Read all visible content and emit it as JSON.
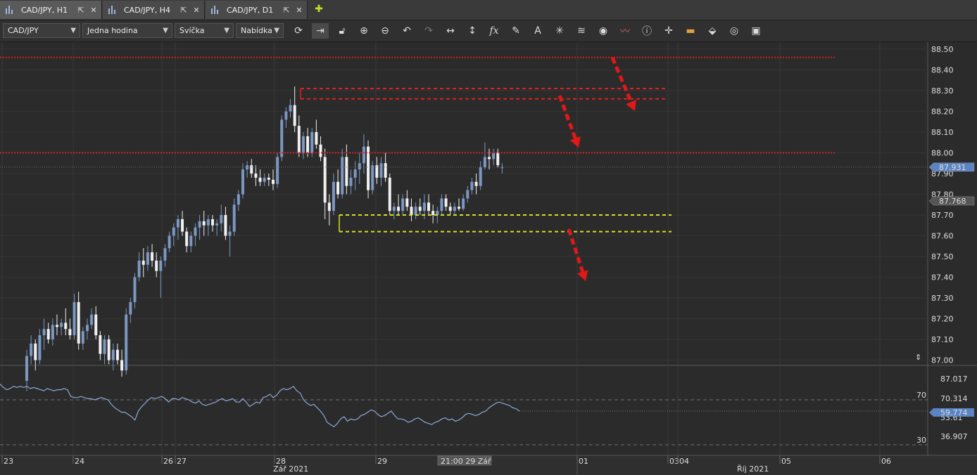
{
  "tabs": [
    {
      "label": "CAD/JPY, H1",
      "active": true
    },
    {
      "label": "CAD/JPY, H4",
      "active": false
    },
    {
      "label": "CAD/JPY, D1",
      "active": false
    }
  ],
  "toolbar": {
    "symbol": "CAD/JPY",
    "timeframe": "Jedna hodina",
    "chart_type": "Svíčka",
    "menu": "Nabídka"
  },
  "chart_data": [
    {
      "type": "candlestick",
      "title": "CAD/JPY, H1",
      "ylim": [
        87.0,
        88.55
      ],
      "y_ticks": [
        "88.50",
        "88.40",
        "88.30",
        "88.20",
        "88.10",
        "88.00",
        "87.90",
        "87.80",
        "87.70",
        "87.60",
        "87.50",
        "87.40",
        "87.30",
        "87.20",
        "87.10",
        "87.00"
      ],
      "x_ticks": [
        "23",
        "24",
        "26",
        "27",
        "28",
        "29",
        "01",
        "03",
        "04",
        "05",
        "06"
      ],
      "x_group_labels": [
        "Zář 2021",
        "Říj 2021"
      ],
      "crosshair_time_label": "21:00 29 Zář",
      "price_labels": [
        {
          "value": "87.931",
          "color": "#5b84c4"
        },
        {
          "value": "87.768",
          "color": "#555555"
        }
      ],
      "bull_color": "#7b97c2",
      "bear_color": "#f0f0f0",
      "candles": [
        {
          "o": 86.9,
          "h": 87.05,
          "l": 86.85,
          "c": 87.02
        },
        {
          "o": 87.02,
          "h": 87.12,
          "l": 86.98,
          "c": 87.08
        },
        {
          "o": 87.08,
          "h": 87.1,
          "l": 86.95,
          "c": 87.0
        },
        {
          "o": 87.0,
          "h": 87.15,
          "l": 86.98,
          "c": 87.12
        },
        {
          "o": 87.12,
          "h": 87.2,
          "l": 87.05,
          "c": 87.15
        },
        {
          "o": 87.15,
          "h": 87.18,
          "l": 87.08,
          "c": 87.1
        },
        {
          "o": 87.1,
          "h": 87.2,
          "l": 87.07,
          "c": 87.17
        },
        {
          "o": 87.17,
          "h": 87.22,
          "l": 87.12,
          "c": 87.16
        },
        {
          "o": 87.16,
          "h": 87.2,
          "l": 87.12,
          "c": 87.18
        },
        {
          "o": 87.18,
          "h": 87.25,
          "l": 87.12,
          "c": 87.15
        },
        {
          "o": 87.15,
          "h": 87.2,
          "l": 87.1,
          "c": 87.12
        },
        {
          "o": 87.12,
          "h": 87.32,
          "l": 87.1,
          "c": 87.28
        },
        {
          "o": 87.28,
          "h": 87.33,
          "l": 87.05,
          "c": 87.08
        },
        {
          "o": 87.08,
          "h": 87.16,
          "l": 87.05,
          "c": 87.14
        },
        {
          "o": 87.14,
          "h": 87.2,
          "l": 87.1,
          "c": 87.17
        },
        {
          "o": 87.17,
          "h": 87.25,
          "l": 87.15,
          "c": 87.22
        },
        {
          "o": 87.22,
          "h": 87.26,
          "l": 87.1,
          "c": 87.12
        },
        {
          "o": 87.12,
          "h": 87.14,
          "l": 87.0,
          "c": 87.03
        },
        {
          "o": 87.03,
          "h": 87.12,
          "l": 86.98,
          "c": 87.1
        },
        {
          "o": 87.1,
          "h": 87.12,
          "l": 86.98,
          "c": 87.0
        },
        {
          "o": 87.0,
          "h": 87.08,
          "l": 86.95,
          "c": 87.05
        },
        {
          "o": 87.05,
          "h": 87.08,
          "l": 86.98,
          "c": 87.0
        },
        {
          "o": 87.0,
          "h": 87.05,
          "l": 86.92,
          "c": 86.95
        },
        {
          "o": 86.95,
          "h": 87.25,
          "l": 86.93,
          "c": 87.22
        },
        {
          "o": 87.22,
          "h": 87.3,
          "l": 87.18,
          "c": 87.28
        },
        {
          "o": 87.28,
          "h": 87.42,
          "l": 87.25,
          "c": 87.4
        },
        {
          "o": 87.4,
          "h": 87.52,
          "l": 87.38,
          "c": 87.48
        },
        {
          "o": 87.48,
          "h": 87.54,
          "l": 87.4,
          "c": 87.46
        },
        {
          "o": 87.46,
          "h": 87.55,
          "l": 87.43,
          "c": 87.52
        },
        {
          "o": 87.52,
          "h": 87.56,
          "l": 87.45,
          "c": 87.48
        },
        {
          "o": 87.48,
          "h": 87.52,
          "l": 87.4,
          "c": 87.43
        },
        {
          "o": 87.43,
          "h": 87.5,
          "l": 87.3,
          "c": 87.48
        },
        {
          "o": 87.48,
          "h": 87.56,
          "l": 87.45,
          "c": 87.54
        },
        {
          "o": 87.54,
          "h": 87.62,
          "l": 87.52,
          "c": 87.6
        },
        {
          "o": 87.6,
          "h": 87.66,
          "l": 87.55,
          "c": 87.64
        },
        {
          "o": 87.64,
          "h": 87.7,
          "l": 87.58,
          "c": 87.68
        },
        {
          "o": 87.68,
          "h": 87.72,
          "l": 87.6,
          "c": 87.62
        },
        {
          "o": 87.62,
          "h": 87.64,
          "l": 87.52,
          "c": 87.55
        },
        {
          "o": 87.55,
          "h": 87.62,
          "l": 87.52,
          "c": 87.6
        },
        {
          "o": 87.6,
          "h": 87.66,
          "l": 87.55,
          "c": 87.64
        },
        {
          "o": 87.64,
          "h": 87.7,
          "l": 87.58,
          "c": 87.67
        },
        {
          "o": 87.67,
          "h": 87.72,
          "l": 87.6,
          "c": 87.65
        },
        {
          "o": 87.65,
          "h": 87.7,
          "l": 87.6,
          "c": 87.68
        },
        {
          "o": 87.68,
          "h": 87.7,
          "l": 87.62,
          "c": 87.65
        },
        {
          "o": 87.65,
          "h": 87.68,
          "l": 87.6,
          "c": 87.66
        },
        {
          "o": 87.66,
          "h": 87.75,
          "l": 87.62,
          "c": 87.7
        },
        {
          "o": 87.7,
          "h": 87.74,
          "l": 87.58,
          "c": 87.6
        },
        {
          "o": 87.6,
          "h": 87.65,
          "l": 87.5,
          "c": 87.62
        },
        {
          "o": 87.62,
          "h": 87.78,
          "l": 87.6,
          "c": 87.75
        },
        {
          "o": 87.75,
          "h": 87.82,
          "l": 87.72,
          "c": 87.8
        },
        {
          "o": 87.8,
          "h": 87.95,
          "l": 87.78,
          "c": 87.92
        },
        {
          "o": 87.92,
          "h": 87.96,
          "l": 87.88,
          "c": 87.94
        },
        {
          "o": 87.94,
          "h": 87.97,
          "l": 87.88,
          "c": 87.9
        },
        {
          "o": 87.9,
          "h": 87.94,
          "l": 87.84,
          "c": 87.88
        },
        {
          "o": 87.88,
          "h": 87.92,
          "l": 87.84,
          "c": 87.86
        },
        {
          "o": 87.86,
          "h": 87.9,
          "l": 87.84,
          "c": 87.88
        },
        {
          "o": 87.88,
          "h": 87.9,
          "l": 87.84,
          "c": 87.87
        },
        {
          "o": 87.87,
          "h": 87.92,
          "l": 87.82,
          "c": 87.85
        },
        {
          "o": 87.85,
          "h": 88.0,
          "l": 87.83,
          "c": 87.98
        },
        {
          "o": 87.98,
          "h": 88.18,
          "l": 87.96,
          "c": 88.16
        },
        {
          "o": 88.16,
          "h": 88.22,
          "l": 88.12,
          "c": 88.2
        },
        {
          "o": 88.2,
          "h": 88.26,
          "l": 88.17,
          "c": 88.23
        },
        {
          "o": 88.23,
          "h": 88.32,
          "l": 88.1,
          "c": 88.13
        },
        {
          "o": 88.13,
          "h": 88.18,
          "l": 87.98,
          "c": 88.0
        },
        {
          "o": 88.0,
          "h": 88.1,
          "l": 87.97,
          "c": 88.08
        },
        {
          "o": 88.08,
          "h": 88.12,
          "l": 87.98,
          "c": 88.0
        },
        {
          "o": 88.0,
          "h": 88.12,
          "l": 87.98,
          "c": 88.1
        },
        {
          "o": 88.1,
          "h": 88.16,
          "l": 88.02,
          "c": 88.04
        },
        {
          "o": 88.04,
          "h": 88.08,
          "l": 87.96,
          "c": 87.98
        },
        {
          "o": 87.98,
          "h": 88.02,
          "l": 87.68,
          "c": 87.76
        },
        {
          "o": 87.76,
          "h": 87.8,
          "l": 87.65,
          "c": 87.72
        },
        {
          "o": 87.72,
          "h": 87.9,
          "l": 87.7,
          "c": 87.86
        },
        {
          "o": 87.86,
          "h": 87.92,
          "l": 87.78,
          "c": 87.8
        },
        {
          "o": 87.8,
          "h": 88.02,
          "l": 87.78,
          "c": 87.98
        },
        {
          "o": 87.98,
          "h": 88.04,
          "l": 87.8,
          "c": 87.84
        },
        {
          "o": 87.84,
          "h": 87.92,
          "l": 87.8,
          "c": 87.88
        },
        {
          "o": 87.88,
          "h": 87.96,
          "l": 87.82,
          "c": 87.92
        },
        {
          "o": 87.92,
          "h": 88.0,
          "l": 87.85,
          "c": 87.95
        },
        {
          "o": 87.95,
          "h": 88.09,
          "l": 87.9,
          "c": 88.03
        },
        {
          "o": 88.03,
          "h": 88.06,
          "l": 87.78,
          "c": 87.82
        },
        {
          "o": 87.82,
          "h": 87.96,
          "l": 87.8,
          "c": 87.94
        },
        {
          "o": 87.94,
          "h": 87.98,
          "l": 87.85,
          "c": 87.88
        },
        {
          "o": 87.88,
          "h": 87.98,
          "l": 87.84,
          "c": 87.95
        },
        {
          "o": 87.95,
          "h": 88.0,
          "l": 87.86,
          "c": 87.88
        },
        {
          "o": 87.88,
          "h": 87.9,
          "l": 87.7,
          "c": 87.72
        },
        {
          "o": 87.72,
          "h": 87.76,
          "l": 87.68,
          "c": 87.74
        },
        {
          "o": 87.74,
          "h": 87.8,
          "l": 87.7,
          "c": 87.72
        },
        {
          "o": 87.72,
          "h": 87.8,
          "l": 87.7,
          "c": 87.78
        },
        {
          "o": 87.78,
          "h": 87.82,
          "l": 87.72,
          "c": 87.74
        },
        {
          "o": 87.74,
          "h": 87.78,
          "l": 87.67,
          "c": 87.7
        },
        {
          "o": 87.7,
          "h": 87.76,
          "l": 87.68,
          "c": 87.74
        },
        {
          "o": 87.74,
          "h": 87.78,
          "l": 87.7,
          "c": 87.72
        },
        {
          "o": 87.72,
          "h": 87.8,
          "l": 87.68,
          "c": 87.76
        },
        {
          "o": 87.76,
          "h": 87.8,
          "l": 87.7,
          "c": 87.72
        },
        {
          "o": 87.72,
          "h": 87.75,
          "l": 87.66,
          "c": 87.7
        },
        {
          "o": 87.7,
          "h": 87.74,
          "l": 87.66,
          "c": 87.72
        },
        {
          "o": 87.72,
          "h": 87.8,
          "l": 87.7,
          "c": 87.78
        },
        {
          "o": 87.78,
          "h": 87.8,
          "l": 87.72,
          "c": 87.74
        },
        {
          "o": 87.74,
          "h": 87.76,
          "l": 87.7,
          "c": 87.72
        },
        {
          "o": 87.72,
          "h": 87.76,
          "l": 87.7,
          "c": 87.74
        },
        {
          "o": 87.74,
          "h": 87.78,
          "l": 87.72,
          "c": 87.73
        },
        {
          "o": 87.73,
          "h": 87.8,
          "l": 87.72,
          "c": 87.78
        },
        {
          "o": 87.78,
          "h": 87.84,
          "l": 87.76,
          "c": 87.82
        },
        {
          "o": 87.82,
          "h": 87.88,
          "l": 87.8,
          "c": 87.86
        },
        {
          "o": 87.86,
          "h": 87.9,
          "l": 87.8,
          "c": 87.84
        },
        {
          "o": 87.84,
          "h": 87.96,
          "l": 87.82,
          "c": 87.93
        },
        {
          "o": 87.93,
          "h": 88.05,
          "l": 87.92,
          "c": 87.98
        },
        {
          "o": 87.98,
          "h": 88.02,
          "l": 87.92,
          "c": 87.97
        },
        {
          "o": 87.97,
          "h": 88.02,
          "l": 87.94,
          "c": 88.0
        },
        {
          "o": 88.0,
          "h": 88.02,
          "l": 87.93,
          "c": 87.94
        },
        {
          "o": 87.93,
          "h": 87.95,
          "l": 87.9,
          "c": 87.93
        }
      ],
      "horizontal_lines": [
        {
          "value": 88.46,
          "color": "#d02020",
          "style": "dotted",
          "from": "start",
          "to": "end"
        },
        {
          "value": 88.31,
          "color": "#e02020",
          "style": "dashed",
          "from": "28",
          "to": "03"
        },
        {
          "value": 88.26,
          "color": "#e02020",
          "style": "dashed",
          "from": "28",
          "to": "03"
        },
        {
          "value": 88.0,
          "color": "#d02020",
          "style": "dotted",
          "from": "start",
          "to": "end"
        },
        {
          "value": 87.7,
          "color": "#d4e020",
          "style": "dashed",
          "from": "28",
          "to": "03"
        },
        {
          "value": 87.62,
          "color": "#d4e020",
          "style": "dashed",
          "from": "28",
          "to": "03"
        }
      ],
      "arrows_color": "#e01818"
    },
    {
      "type": "line",
      "name": "RSI",
      "ylim": [
        30,
        90
      ],
      "y_ticks": [
        "87.017",
        "70.314",
        "53.61",
        "36.907"
      ],
      "levels": [
        "70",
        "30"
      ],
      "current_value": "59.774",
      "color": "#8ea8d8",
      "values": [
        84,
        81,
        79,
        80,
        82,
        81,
        82,
        81,
        82,
        80,
        81,
        80,
        79,
        78,
        80,
        79,
        78,
        79,
        79,
        80,
        79,
        73,
        72,
        72,
        73,
        72,
        71,
        71,
        70,
        71,
        72,
        71,
        70,
        66,
        63,
        61,
        59,
        59,
        57,
        55,
        52,
        60,
        64,
        67,
        70,
        72,
        71,
        72,
        73,
        71,
        68,
        71,
        71,
        70,
        72,
        71,
        70,
        68,
        67,
        69,
        66,
        65,
        66,
        67,
        68,
        70,
        71,
        69,
        70,
        71,
        68,
        68,
        71,
        68,
        64,
        66,
        68,
        67,
        72,
        73,
        75,
        72,
        74,
        78,
        80,
        79,
        80,
        82,
        78,
        76,
        70,
        67,
        65,
        66,
        63,
        60,
        56,
        50,
        48,
        46,
        49,
        53,
        55,
        51,
        53,
        52,
        53,
        56,
        57,
        59,
        61,
        60,
        57,
        55,
        56,
        58,
        60,
        56,
        53,
        53,
        52,
        50,
        51,
        53,
        54,
        52,
        50,
        49,
        48,
        50,
        51,
        53,
        54,
        52,
        53,
        51,
        52,
        54,
        57,
        58,
        57,
        56,
        57,
        59,
        60,
        63,
        65,
        67,
        68,
        67,
        66,
        65,
        63,
        62,
        60
      ]
    }
  ]
}
